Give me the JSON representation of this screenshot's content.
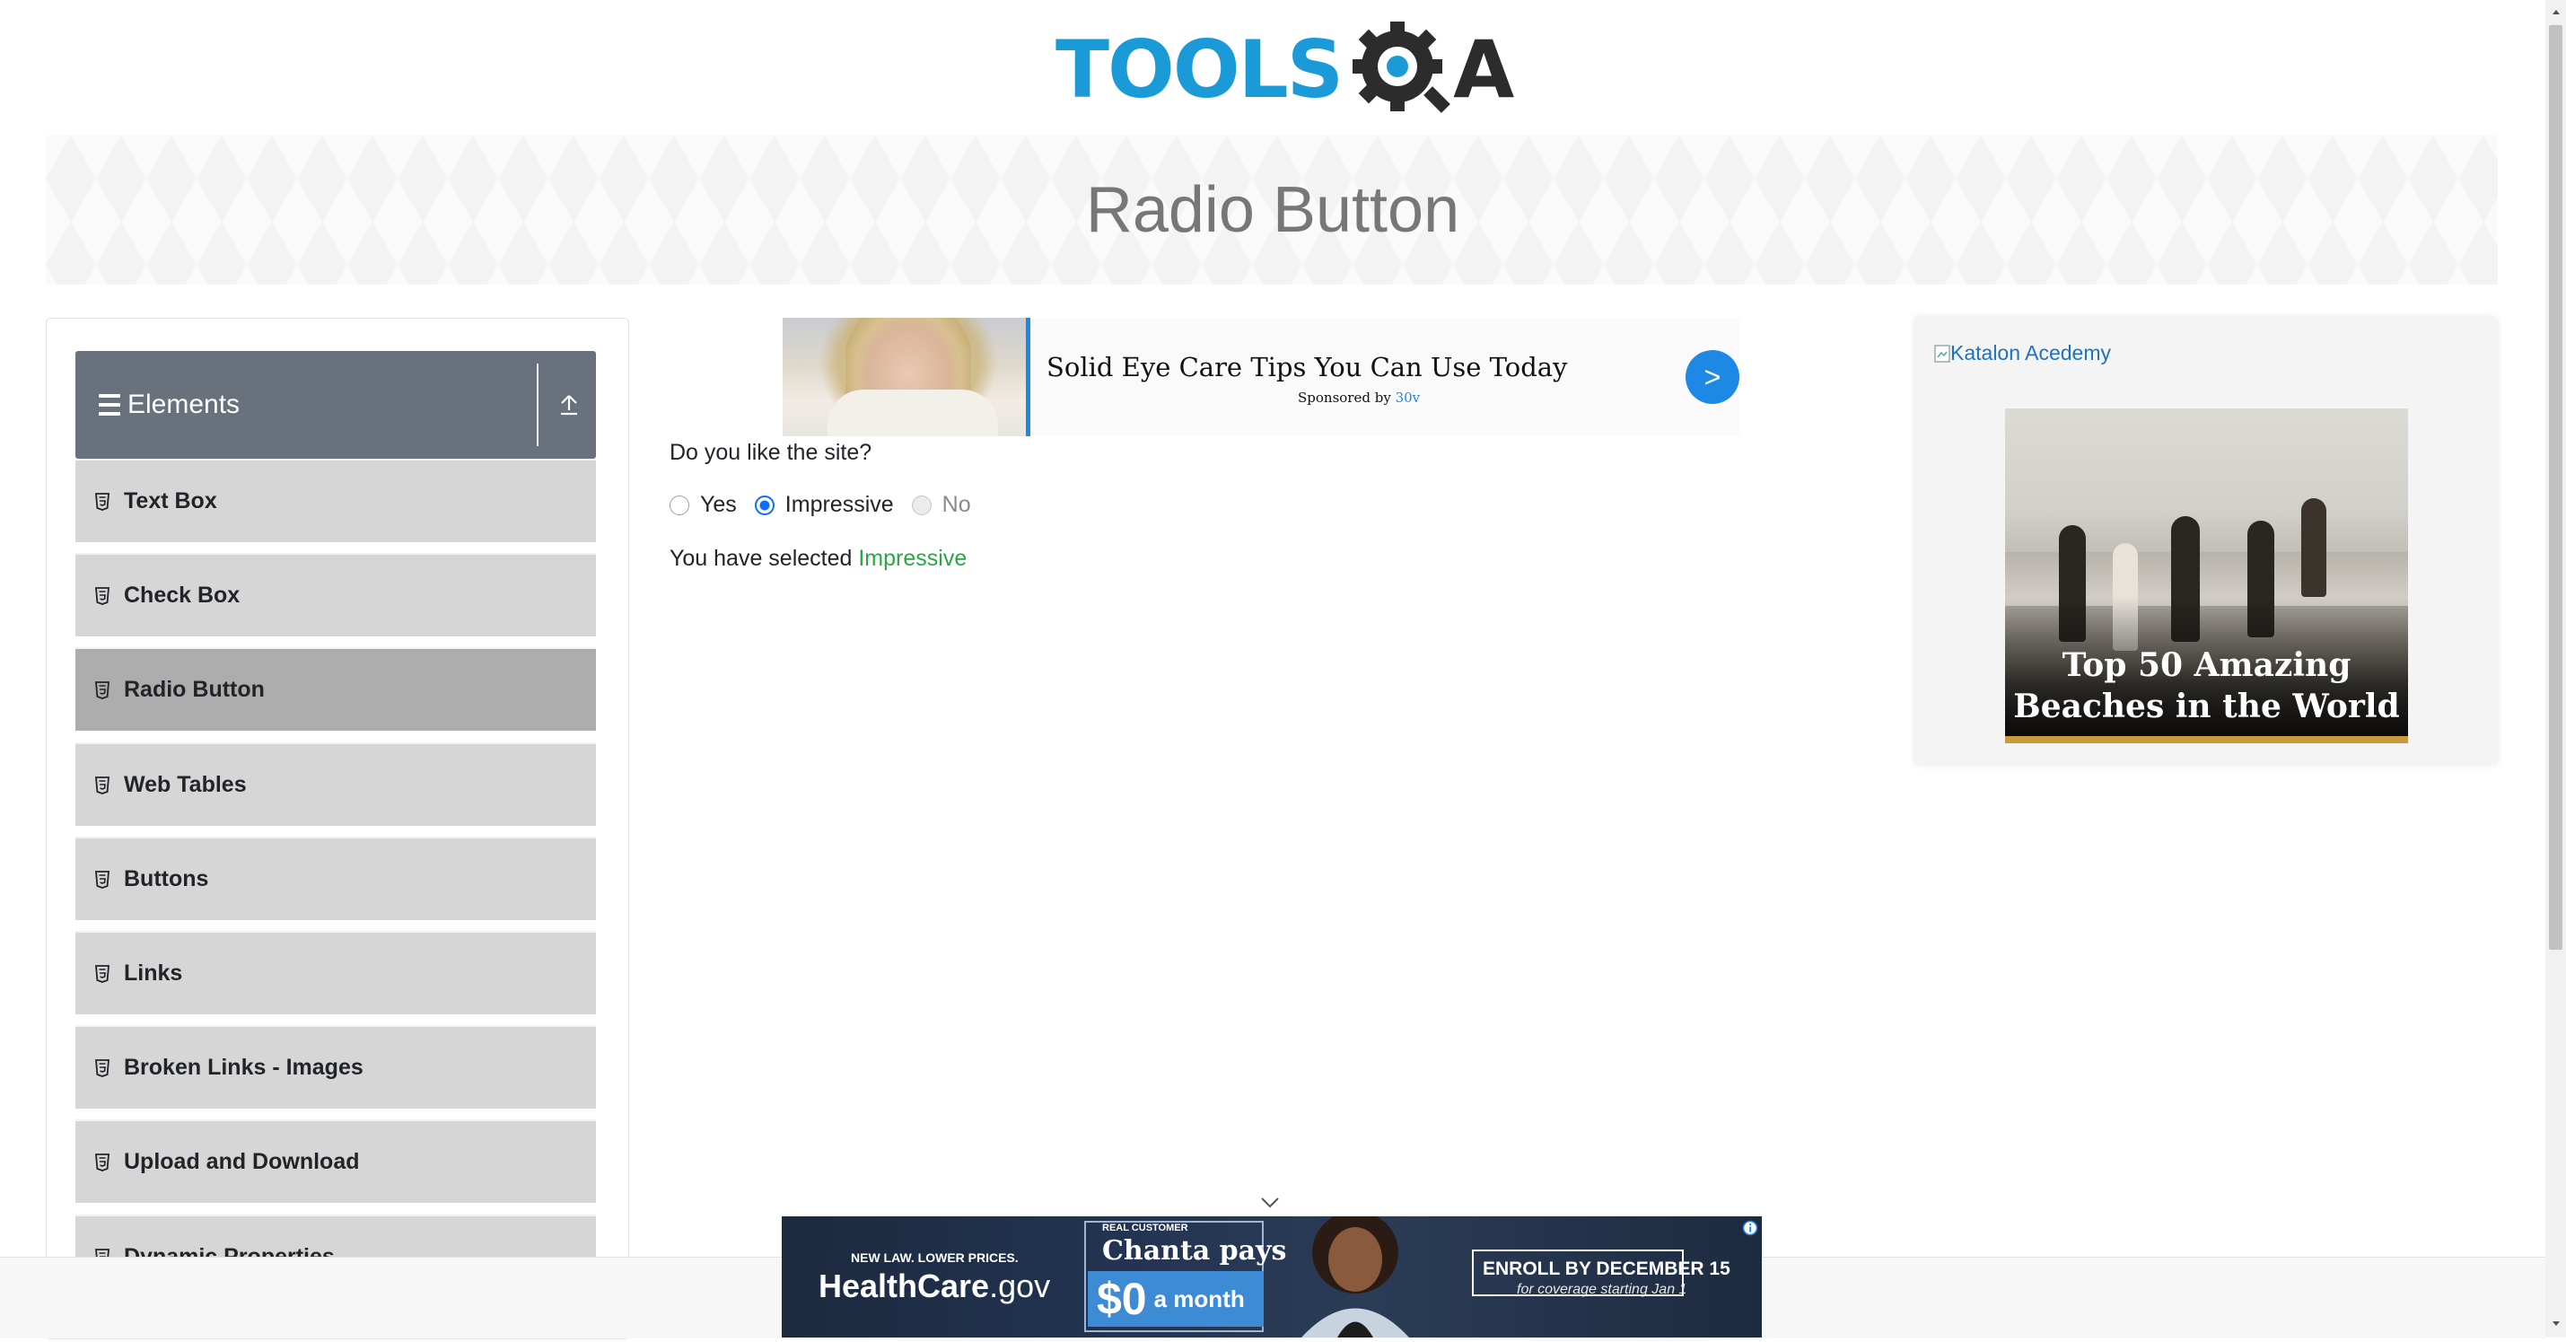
{
  "header": {
    "logo_tools": "TOOLS",
    "logo_qa": "A"
  },
  "page": {
    "title": "Radio Button"
  },
  "sidebar": {
    "group_title": "Elements",
    "items": [
      {
        "label": "Text Box",
        "active": false
      },
      {
        "label": "Check Box",
        "active": false
      },
      {
        "label": "Radio Button",
        "active": true
      },
      {
        "label": "Web Tables",
        "active": false
      },
      {
        "label": "Buttons",
        "active": false
      },
      {
        "label": "Links",
        "active": false
      },
      {
        "label": "Broken Links - Images",
        "active": false
      },
      {
        "label": "Upload and Download",
        "active": false
      },
      {
        "label": "Dynamic Properties",
        "active": false
      }
    ]
  },
  "ad_top": {
    "title": "Solid Eye Care Tips You Can Use Today",
    "sponsor_prefix": "Sponsored by",
    "sponsor_name": "30v",
    "cta": ">"
  },
  "form": {
    "question": "Do you like the site?",
    "options": [
      {
        "label": "Yes",
        "checked": false,
        "disabled": false
      },
      {
        "label": "Impressive",
        "checked": true,
        "disabled": false
      },
      {
        "label": "No",
        "checked": false,
        "disabled": true
      }
    ],
    "result_prefix": "You have selected",
    "result_value": "Impressive"
  },
  "ad_right": {
    "image_alt": "Katalon Acedemy",
    "caption": "Top 50 Amazing Beaches in the World"
  },
  "ad_bottom": {
    "tagline": "NEW LAW. LOWER PRICES.",
    "brand_main": "HealthCare",
    "brand_suffix": ".gov",
    "customer_tag": "REAL CUSTOMER",
    "customer_name": "Chanta pays",
    "price": "$0",
    "price_unit": "a month",
    "enroll": "ENROLL BY DECEMBER 15",
    "enroll_sub": "for coverage starting Jan 1"
  },
  "colors": {
    "brand_blue": "#1a9bd7",
    "sidebar_header": "#68717c",
    "active_item": "#adadad",
    "item_bg": "#d6d6d6",
    "selected_text": "#28a745",
    "radio_blue": "#0d6efd"
  }
}
